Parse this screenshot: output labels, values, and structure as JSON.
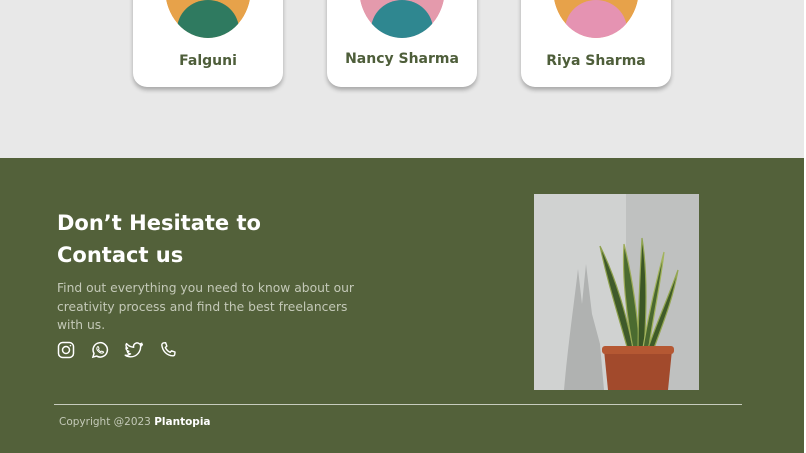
{
  "team": {
    "members": [
      {
        "name": "Falguni",
        "avatar_colors": {
          "skin": "#e7a24a",
          "shirt": "#2f7a60"
        }
      },
      {
        "name": "Nancy Sharma",
        "avatar_colors": {
          "skin": "#e49aac",
          "shirt": "#2f8790"
        }
      },
      {
        "name": "Riya Sharma",
        "avatar_colors": {
          "skin": "#e7a24a",
          "shirt": "#e593b2"
        }
      }
    ]
  },
  "footer": {
    "heading_line1": "Don’t Hesitate to",
    "heading_line2": "Contact us",
    "description": "Find out everything you need to know about our creativity process and find the best freelancers with us.",
    "socials": [
      {
        "icon": "instagram-icon"
      },
      {
        "icon": "whatsapp-icon"
      },
      {
        "icon": "twitter-icon"
      },
      {
        "icon": "phone-icon"
      }
    ],
    "copyright_prefix": "Copyright @2023",
    "brand": "Plantopia"
  },
  "colors": {
    "page_bg": "#e8e8e8",
    "footer_bg": "#53613a",
    "name_text": "#4e5e3a",
    "heading": "#ffffff",
    "muted_text": "#c4c9b8"
  }
}
